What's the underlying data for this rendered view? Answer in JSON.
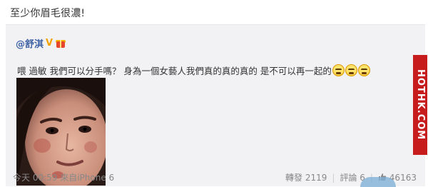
{
  "header": {
    "comment_text": "至少你眉毛很濃!"
  },
  "post": {
    "author": "@舒淇",
    "badge": "V",
    "text": "喂 過敏 我們可以分手嗎？ 身為一個女藝人我們真的真的真的 是不可以再一起的",
    "emoji_count": 3,
    "watermark": "HOTHK.COM"
  },
  "footer": {
    "time_source": "今天 00:59 來自iPhone 6",
    "repost_label": "轉發",
    "repost_count": "2119",
    "comment_label": "評論",
    "comment_count": "6",
    "like_count": "46163",
    "separator": "|"
  },
  "colors": {
    "author": "#3f63a4",
    "badge": "#f2a100",
    "watermark_bg": "#c61c1c"
  },
  "icons": [
    "gift-icon",
    "tearful-laugh-emoji-icon",
    "thumbs-up-icon"
  ]
}
